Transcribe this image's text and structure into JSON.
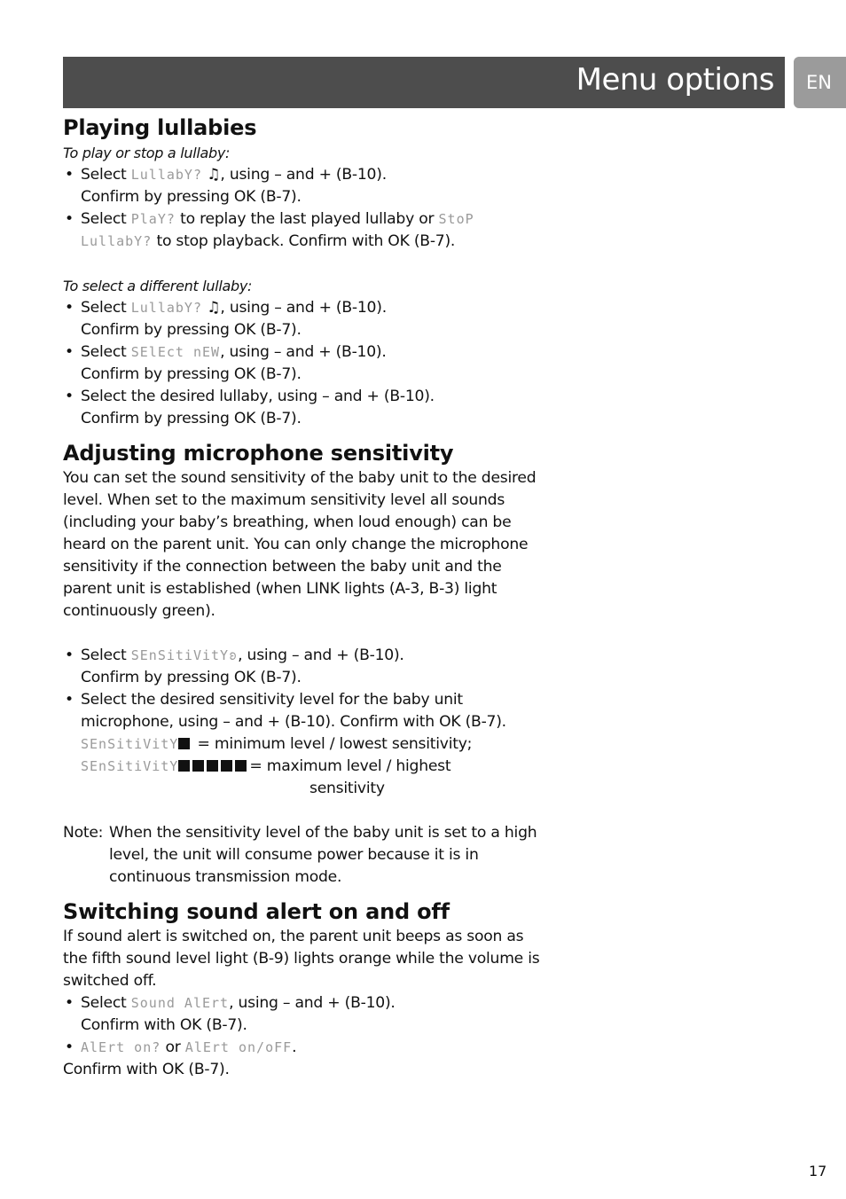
{
  "header": {
    "title": "Menu options",
    "lang_tab": "EN"
  },
  "sections": {
    "lullabies": {
      "heading": "Playing lullabies",
      "sub1": "To play or stop a lullaby:",
      "b1_pre": "Select ",
      "b1_lcd": "LullabY?",
      "b1_icon": "♫",
      "b1_post": ", using – and + (B-10).",
      "b1_line2": "Confirm by pressing OK (B-7).",
      "b2_pre": "Select ",
      "b2_lcd1": "PlaY?",
      "b2_mid": " to replay the last played lullaby or ",
      "b2_lcd2": "StoP",
      "b2_lcd3": "LullabY?",
      "b2_post": " to stop playback. Confirm with OK (B-7).",
      "sub2": "To select a different lullaby:",
      "b3_pre": "Select ",
      "b3_lcd": "LullabY?",
      "b3_icon": "♫",
      "b3_post": ", using – and + (B-10).",
      "b3_line2": "Confirm by pressing OK (B-7).",
      "b4_pre": "Select ",
      "b4_lcd": "SElEct nEW",
      "b4_post": ", using – and + (B-10).",
      "b4_line2": "Confirm by pressing OK (B-7).",
      "b5_line1": "Select the desired lullaby, using – and + (B-10).",
      "b5_line2": "Confirm by pressing OK (B-7)."
    },
    "microphone": {
      "heading": "Adjusting microphone sensitivity",
      "paragraph": "You can set the sound sensitivity of the baby unit to the desired level. When set to the maximum sensitivity level all sounds (including your baby’s breathing, when loud enough) can be heard on the parent unit. You can only change the microphone sensitivity if the connection between the baby unit and the parent unit is established (when LINK lights (A-3, B-3) light continuously green).",
      "b1_pre": "Select ",
      "b1_lcd": "SEnSitiVitY",
      "b1_icon": "ʚ",
      "b1_post": ", using – and + (B-10).",
      "b1_line2": "Confirm by pressing OK (B-7).",
      "b2_line1": "Select the desired sensitivity level for the baby unit",
      "b2_line2": "microphone, using – and + (B-10). Confirm with OK (B-7).",
      "min_lcd": "SEnSitiVitY",
      "min_level": 1,
      "min_text": " = minimum level / lowest sensitivity;",
      "max_lcd": "SEnSitiVitY",
      "max_level": 5,
      "max_text": "= maximum level / highest",
      "max_text2": "sensitivity",
      "note_label": "Note:",
      "note_text": "When the sensitivity level of the baby unit is set to a high level, the unit will consume power because it is in continuous transmission mode."
    },
    "alert": {
      "heading": "Switching sound alert on and off",
      "paragraph": "If sound alert is switched on, the parent unit beeps as soon as the fifth sound level light (B-9) lights orange while the volume is switched off.",
      "b1_pre": "Select ",
      "b1_lcd": "Sound AlErt",
      "b1_post": ", using – and + (B-10).",
      "b1_line2": "Confirm with OK (B-7).",
      "b2_lcd1": "AlErt on?",
      "b2_mid": " or ",
      "b2_lcd2": "AlErt on/oFF",
      "b2_post": ".",
      "final": "Confirm with OK (B-7)."
    }
  },
  "page_number": "17"
}
